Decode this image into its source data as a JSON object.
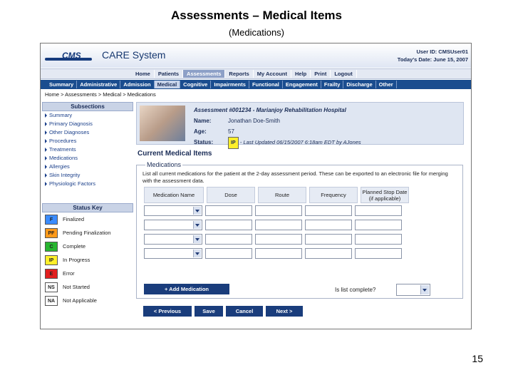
{
  "slide": {
    "title": "Assessments – Medical Items",
    "subtitle": "(Medications)",
    "page_number": "15"
  },
  "header": {
    "logo_text": "CMS",
    "system_name": "CARE System",
    "user_id": "User ID: CMSUser01",
    "date": "Today's Date: June 15, 2007"
  },
  "main_nav": {
    "items": [
      "Home",
      "Patients",
      "Assessments",
      "Reports",
      "My Account",
      "Help",
      "Print",
      "Logout"
    ],
    "active": "Assessments"
  },
  "sub_nav": {
    "items": [
      "Summary",
      "Administrative",
      "Admission",
      "Medical",
      "Cognitive",
      "Impairments",
      "Functional",
      "Engagement",
      "Frailty",
      "Discharge",
      "Other"
    ],
    "active": "Medical"
  },
  "breadcrumb": "Home  >  Assessments  >  Medical  >  Medications",
  "sidebar": {
    "subsections_title": "Subsections",
    "subsections": [
      "Summary",
      "Primary Diagnosis",
      "Other Diagnoses",
      "Procedures",
      "Treatments",
      "Medications",
      "Allergies",
      "Skin Integrity",
      "Physiologic Factors"
    ],
    "status_key_title": "Status Key",
    "status_key": [
      {
        "code": "F",
        "label": "Finalized",
        "color": "#3b8cff"
      },
      {
        "code": "PF",
        "label": "Pending Finalization",
        "color": "#ff9a1a"
      },
      {
        "code": "C",
        "label": "Complete",
        "color": "#27b52f"
      },
      {
        "code": "IP",
        "label": "In Progress",
        "color": "#ffef2a"
      },
      {
        "code": "E",
        "label": "Error",
        "color": "#e21f1f"
      },
      {
        "code": "NS",
        "label": "Not Started",
        "color": "#ffffff"
      },
      {
        "code": "NA",
        "label": "Not Applicable",
        "color": "#ffffff"
      }
    ]
  },
  "assessment": {
    "title": "Assessment #001234 - Marianjoy Rehabilitation Hospital",
    "name_label": "Name:",
    "name_value": "Jonathan Doe-Smith",
    "age_label": "Age:",
    "age_value": "57",
    "status_label": "Status:",
    "status_value": "IP",
    "last_updated": "- Last Updated 06/15/2007 6:18am EDT by AJones"
  },
  "section": {
    "title": "Current Medical Items",
    "legend": "Medications",
    "description": "List all current medications for the patient at the 2-day assessment period. These can be exported to an electronic file for merging with the assessment data.",
    "columns": [
      "Medication Name",
      "Dose",
      "Route",
      "Frequency",
      "Planned Stop Date (if applicable)"
    ],
    "add_button": "+ Add Medication",
    "is_list_complete": "Is list complete?"
  },
  "actions": {
    "previous": "< Previous",
    "save": "Save",
    "cancel": "Cancel",
    "next": "Next >"
  }
}
